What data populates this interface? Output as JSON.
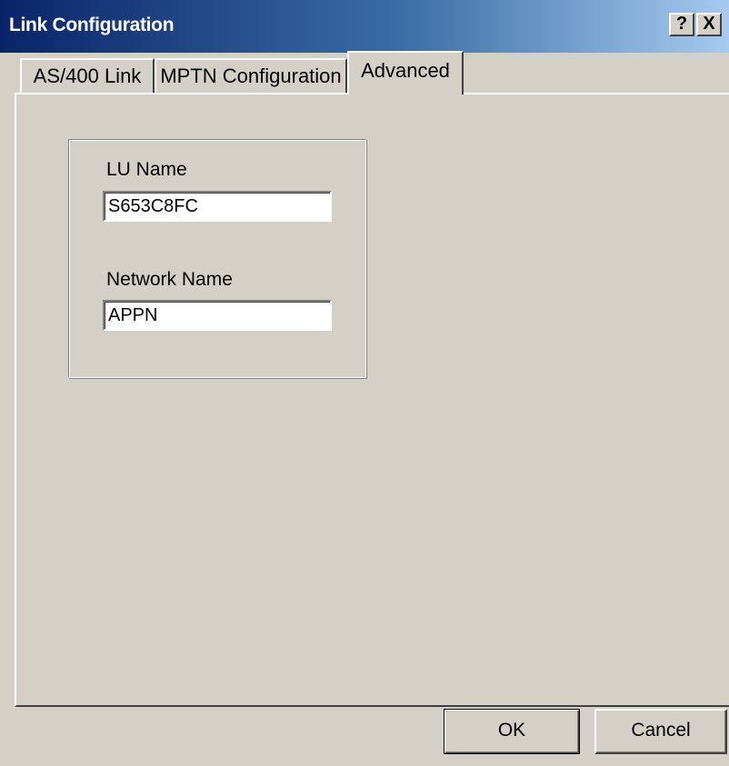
{
  "window": {
    "title": "Link Configuration",
    "help_glyph": "?",
    "close_glyph": "X"
  },
  "tabs": [
    {
      "label": "AS/400 Link",
      "selected": false
    },
    {
      "label": "MPTN Configuration",
      "selected": false
    },
    {
      "label": "Advanced",
      "selected": true
    }
  ],
  "advanced": {
    "lu_name_label": "LU Name",
    "lu_name_value": "S653C8FC",
    "network_name_label": "Network Name",
    "network_name_value": "APPN"
  },
  "buttons": {
    "ok_label": "OK",
    "cancel_label": "Cancel"
  },
  "colors": {
    "title_start": "#0a246a",
    "title_end": "#a6caf0",
    "face": "#d4d0c8"
  },
  "icons": {
    "help": "help-icon",
    "close": "close-icon"
  }
}
